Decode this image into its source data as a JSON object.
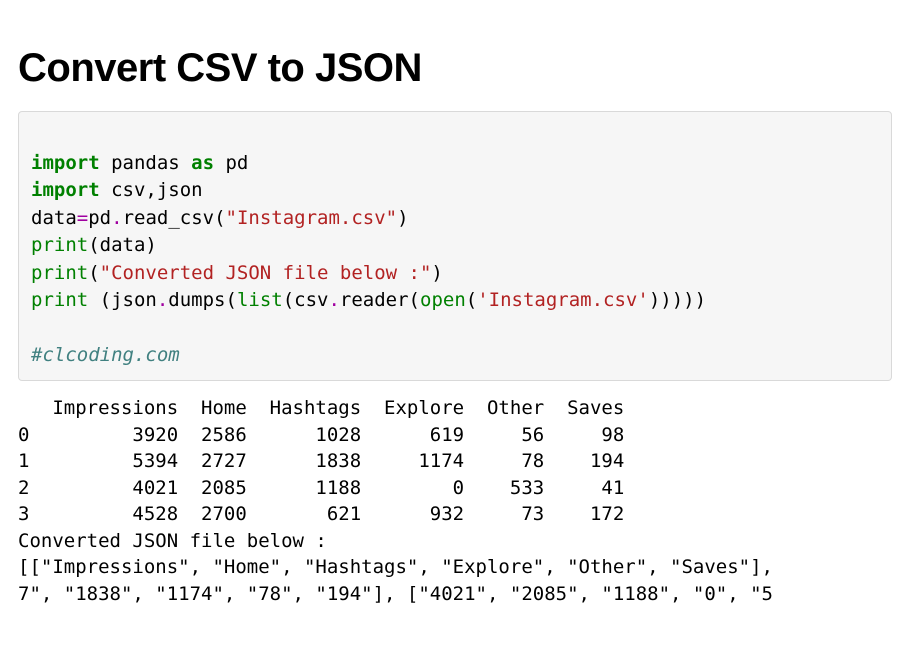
{
  "title": "Convert CSV to JSON",
  "code": {
    "l1_kw1": "import",
    "l1_mod": " pandas ",
    "l1_kw2": "as",
    "l1_alias": " pd",
    "l2_kw": "import",
    "l2_mod": " csv,json",
    "l3_a": "data",
    "l3_op": "=",
    "l3_b": "pd",
    "l3_c": ".",
    "l3_d": "read_csv(",
    "l3_str": "\"Instagram.csv\"",
    "l3_e": ")",
    "l4_fn": "print",
    "l4_rest": "(data)",
    "l5_fn": "print",
    "l5_a": "(",
    "l5_str": "\"Converted JSON file below :\"",
    "l5_b": ")",
    "l6_fn": "print",
    "l6_a": " (json",
    "l6_b": ".",
    "l6_c": "dumps(",
    "l6_fn2": "list",
    "l6_d": "(csv",
    "l6_e": ".",
    "l6_f": "reader(",
    "l6_fn3": "open",
    "l6_g": "(",
    "l6_str": "'Instagram.csv'",
    "l6_h": ")))))",
    "comment": "#clcoding.com"
  },
  "output": {
    "header": "   Impressions  Home  Hashtags  Explore  Other  Saves",
    "r0": "0         3920  2586      1028      619     56     98",
    "r1": "1         5394  2727      1838     1174     78    194",
    "r2": "2         4021  2085      1188        0    533     41",
    "r3": "3         4528  2700       621      932     73    172",
    "msg": "Converted JSON file below :",
    "j1": "[[\"Impressions\", \"Home\", \"Hashtags\", \"Explore\", \"Other\", \"Saves\"],",
    "j2": "7\", \"1838\", \"1174\", \"78\", \"194\"], [\"4021\", \"2085\", \"1188\", \"0\", \"5"
  },
  "chart_data": {
    "type": "table",
    "columns": [
      "Impressions",
      "Home",
      "Hashtags",
      "Explore",
      "Other",
      "Saves"
    ],
    "rows": [
      [
        3920,
        2586,
        1028,
        619,
        56,
        98
      ],
      [
        5394,
        2727,
        1838,
        1174,
        78,
        194
      ],
      [
        4021,
        2085,
        1188,
        0,
        533,
        41
      ],
      [
        4528,
        2700,
        621,
        932,
        73,
        172
      ]
    ]
  }
}
